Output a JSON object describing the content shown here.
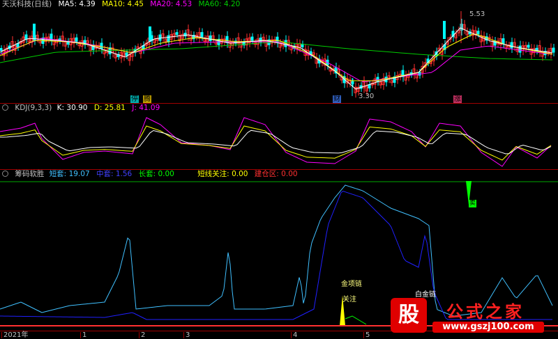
{
  "price_panel": {
    "title": "天沃科技(日线)",
    "ma5": "MA5: 4.39",
    "ma10": "MA10: 4.45",
    "ma20": "MA20: 4.53",
    "ma60": "MA60: 4.20",
    "high_label": "5.53",
    "low_label": "3.30",
    "tags": [
      "停",
      "腾",
      "财",
      "涨"
    ],
    "colors": {
      "ma5": "#ffffff",
      "ma10": "#ffff00",
      "ma20": "#ff00ff",
      "ma60": "#00cc00",
      "up": "#ff3030",
      "down": "#00ffff"
    }
  },
  "kdj_panel": {
    "title": "KDJ(9,3,3)",
    "k": "K: 30.90",
    "d": "D: 25.81",
    "j": "J: 41.09"
  },
  "chip_panel": {
    "title": "筹码软胜",
    "short": "短套: 19.07",
    "mid": "中套: 1.56",
    "long": "长套: 0.00",
    "focus": "短线关注: 0.00",
    "build": "建仓区: 0.00",
    "annotations": {
      "sell": "卖",
      "golden": "金项链",
      "watch": "关注",
      "white": "白金链"
    }
  },
  "x_axis": [
    "2021年",
    "1",
    "2",
    "3",
    "4",
    "5"
  ],
  "watermark": {
    "logo": "股",
    "title": "公式之家",
    "url": "www.gszj100.com"
  }
}
